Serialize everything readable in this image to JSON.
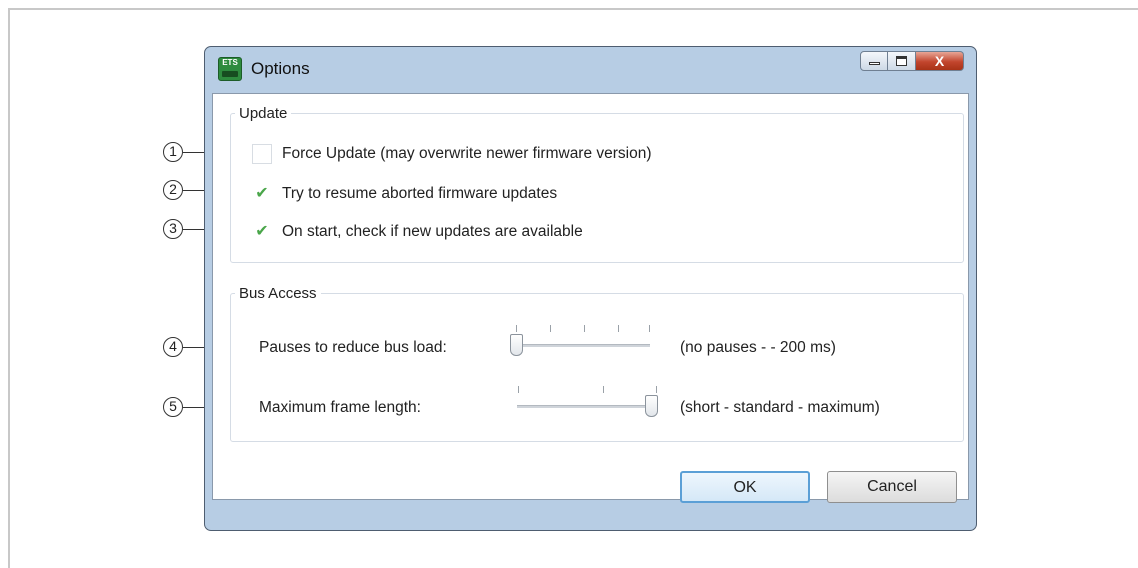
{
  "window": {
    "title": "Options",
    "app_icon_text": "ETS",
    "close_glyph": "X"
  },
  "update": {
    "legend": "Update",
    "options": [
      {
        "label": "Force Update (may overwrite newer firmware version)",
        "checked": false,
        "callout": "1"
      },
      {
        "label": "Try to resume aborted firmware updates",
        "checked": true,
        "callout": "2"
      },
      {
        "label": "On start, check if new updates are available",
        "checked": true,
        "callout": "3"
      }
    ]
  },
  "bus_access": {
    "legend": "Bus Access",
    "pauses": {
      "label": "Pauses to reduce bus load:",
      "range": "(no pauses - - 200 ms)",
      "value_fraction": 0.0,
      "callout": "4"
    },
    "frame": {
      "label": "Maximum frame length:",
      "range": "(short - standard - maximum)",
      "value_fraction": 1.0,
      "callout": "5"
    }
  },
  "buttons": {
    "ok": "OK",
    "cancel": "Cancel"
  },
  "icons": {
    "check": "checkmark-icon",
    "close": "close-icon",
    "minimize": "minimize-icon",
    "maximize": "maximize-icon"
  },
  "colors": {
    "check": "#4aa64a",
    "close_button": "#c2452d",
    "ok_border": "#5b9fd6",
    "window_frame": "#b7cde4"
  }
}
